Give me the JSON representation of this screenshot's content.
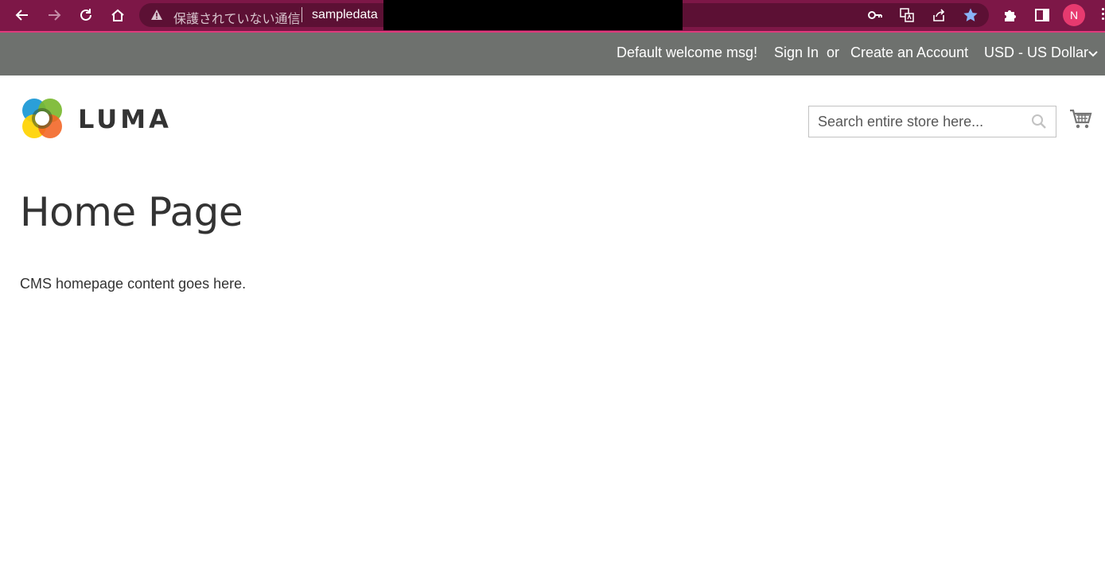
{
  "browser": {
    "security_label": "保護されていない通信",
    "url_visible": "sampledata",
    "profile_initial": "N",
    "colors": {
      "frame": "#7d1747",
      "omnibox": "#5c1034",
      "avatar": "#e73a6f"
    }
  },
  "store_panel": {
    "welcome": "Default welcome msg!",
    "sign_in": "Sign In",
    "or": "or",
    "create_account": "Create an Account",
    "currency": "USD - US Dollar"
  },
  "header": {
    "logo_text": "LUMA",
    "search_placeholder": "Search entire store here..."
  },
  "main": {
    "title": "Home Page",
    "content": "CMS homepage content goes here."
  }
}
